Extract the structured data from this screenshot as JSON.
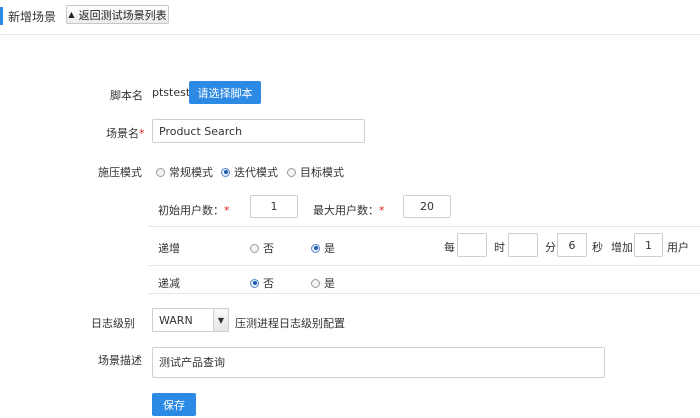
{
  "header": {
    "title": "新增场景",
    "back_label": "返回测试场景列表"
  },
  "form": {
    "script": {
      "label": "脚本名",
      "value": "ptstest",
      "choose_label": "请选择脚本"
    },
    "scene_name": {
      "label": "场景名",
      "required_mark": "*",
      "value": "Product Search"
    },
    "mode": {
      "label": "施压模式",
      "options": [
        "常规模式",
        "迭代模式",
        "目标模式"
      ],
      "selected": "迭代模式"
    },
    "users": {
      "initial_label": "初始用户数：",
      "initial_value": "1",
      "max_label": "最大用户数：",
      "max_value": "20",
      "required_mark": "*"
    },
    "ramp_up": {
      "label": "递增",
      "no_label": "否",
      "yes_label": "是",
      "selected": "是",
      "every_label": "每",
      "hour_value": "",
      "hour_label": "时",
      "minute_value": "",
      "minute_label": "分",
      "second_value": "6",
      "second_label": "秒",
      "increase_label": "增加",
      "increase_value": "1",
      "user_unit": "用户"
    },
    "ramp_down": {
      "label": "递减",
      "no_label": "否",
      "yes_label": "是",
      "selected": "否"
    },
    "log_level": {
      "label": "日志级别",
      "value": "WARN",
      "hint": "压测进程日志级别配置"
    },
    "description": {
      "label": "场景描述",
      "value": "测试产品查询"
    },
    "save_label": "保存"
  },
  "colors": {
    "accent": "#2d8ae4",
    "required": "#d9251c"
  }
}
